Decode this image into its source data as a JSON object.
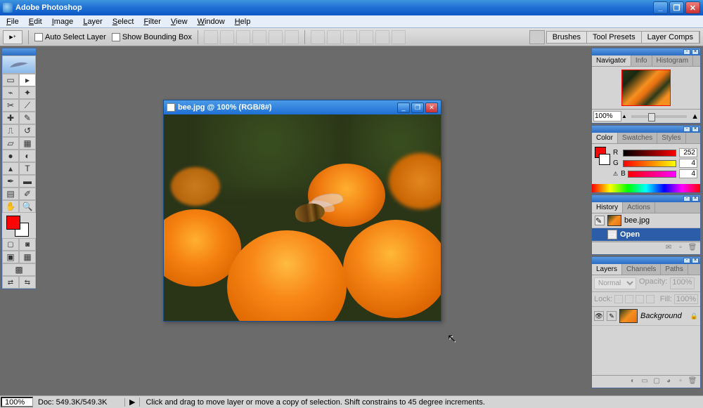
{
  "app": {
    "title": "Adobe Photoshop"
  },
  "menu": [
    "File",
    "Edit",
    "Image",
    "Layer",
    "Select",
    "Filter",
    "View",
    "Window",
    "Help"
  ],
  "options": {
    "auto_select": "Auto Select Layer",
    "bounding": "Show Bounding Box"
  },
  "dock_tabs": [
    "Brushes",
    "Tool Presets",
    "Layer Comps"
  ],
  "navigator": {
    "tabs": [
      "Navigator",
      "Info",
      "Histogram"
    ],
    "zoom": "100%"
  },
  "color": {
    "tabs": [
      "Color",
      "Swatches",
      "Styles"
    ],
    "r_label": "R",
    "r_val": "252",
    "g_label": "G",
    "g_val": "4",
    "b_label": "B",
    "b_val": "4",
    "fg": "#fc0404",
    "bg": "#ffffff"
  },
  "history": {
    "tabs": [
      "History",
      "Actions"
    ],
    "doc": "bee.jpg",
    "step": "Open"
  },
  "layers": {
    "tabs": [
      "Layers",
      "Channels",
      "Paths"
    ],
    "blend": "Normal",
    "opacity_label": "Opacity:",
    "opacity": "100%",
    "lock_label": "Lock:",
    "fill_label": "Fill:",
    "fill": "100%",
    "layer_name": "Background"
  },
  "document": {
    "title": "bee.jpg @ 100% (RGB/8#)"
  },
  "status": {
    "zoom": "100%",
    "doc": "Doc: 549.3K/549.3K",
    "hint": "Click and drag to move layer or move a copy of selection. Shift constrains to 45 degree increments."
  }
}
